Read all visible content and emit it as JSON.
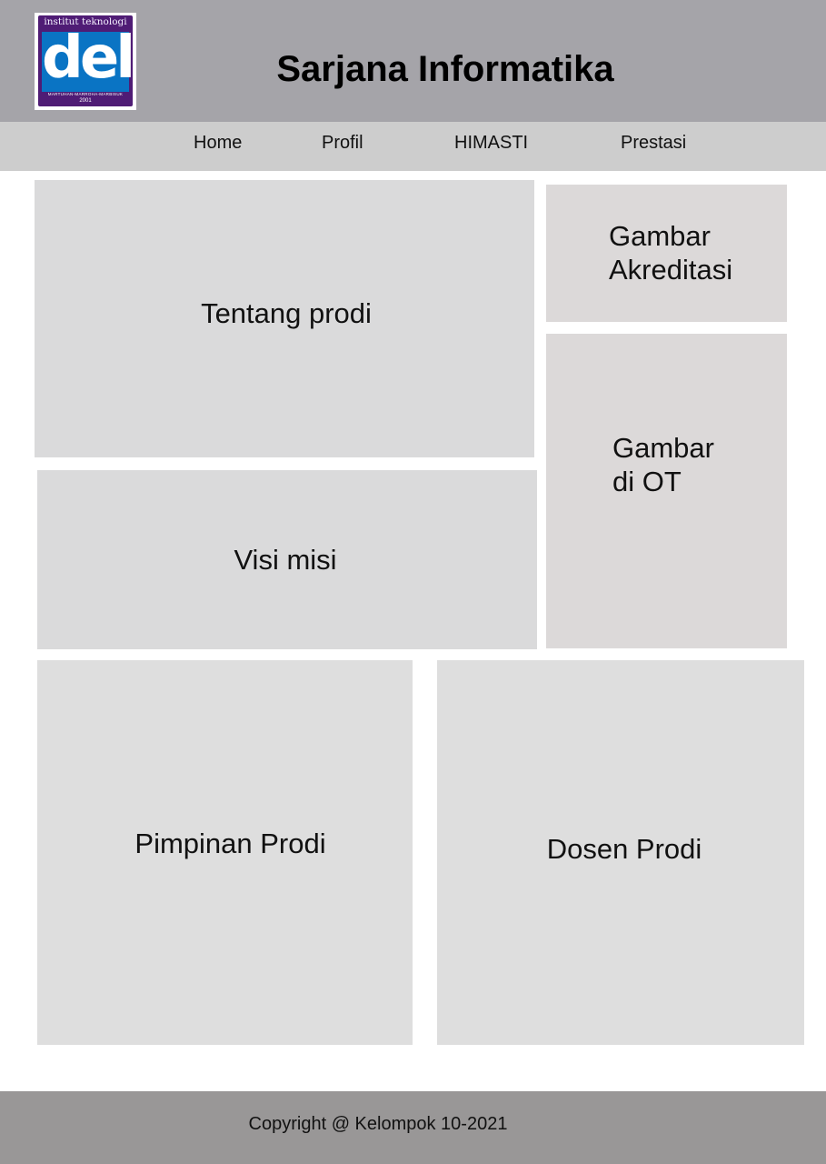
{
  "header": {
    "logo": {
      "top_text": "institut teknologi",
      "main_text": "del",
      "motto": "MARTUHAN-MARROHA-MARBISUK",
      "year": "2001"
    },
    "title": "Sarjana Informatika"
  },
  "nav": {
    "items": [
      {
        "label": "Home"
      },
      {
        "label": "Profil"
      },
      {
        "label": "HIMASTI"
      },
      {
        "label": "Prestasi"
      }
    ]
  },
  "panels": {
    "tentang": "Tentang prodi",
    "visi_misi": "Visi misi",
    "akreditasi": "Gambar\nAkreditasi",
    "ot": "Gambar\ndi OT",
    "pimpinan": "Pimpinan Prodi",
    "dosen": "Dosen Prodi"
  },
  "footer": {
    "copyright": "Copyright @ Kelompok 10-2021"
  },
  "colors": {
    "header_bg": "#a5a4a9",
    "nav_bg": "#cdcdcd",
    "panel_bg": "#dadadb",
    "side_panel_bg": "#dcd9d9",
    "footer_bg": "#999797",
    "logo_purple": "#4f1c75",
    "logo_blue": "#0a74c4"
  }
}
